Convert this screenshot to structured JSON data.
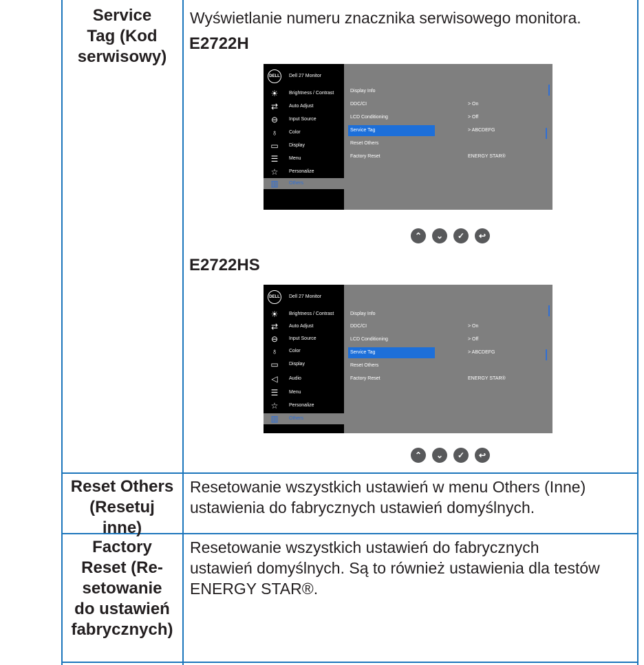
{
  "service_tag": {
    "label": "Service Tag (Kod serwisowy)",
    "label_lines": [
      "Service",
      "Tag (Kod",
      "serwisowy)"
    ],
    "description": "Wyświetlanie numeru znacznika serwisowego monitora.",
    "variants": [
      {
        "model": "E2722H",
        "osd": {
          "title": "Dell 27 Monitor",
          "logo": "DELL",
          "menu": [
            {
              "label": "Brightness / Contrast",
              "icon": "brightness-icon"
            },
            {
              "label": "Auto Adjust",
              "icon": "auto-adjust-icon"
            },
            {
              "label": "Input Source",
              "icon": "input-source-icon"
            },
            {
              "label": "Color",
              "icon": "color-icon"
            },
            {
              "label": "Display",
              "icon": "display-icon"
            },
            {
              "label": "Menu",
              "icon": "menu-icon"
            },
            {
              "label": "Personalize",
              "icon": "star-icon"
            },
            {
              "label": "Others",
              "icon": "others-icon",
              "active": true
            }
          ],
          "submenu": [
            "Display Info",
            "DDC/CI",
            "LCD Conditioning",
            "Service Tag",
            "Reset Others",
            "Factory Reset"
          ],
          "values": [
            "",
            "> On",
            "> Off",
            "> ABCDEFG",
            "",
            "ENERGY STAR®"
          ]
        }
      },
      {
        "model": "E2722HS",
        "osd": {
          "title": "Dell 27 Monitor",
          "logo": "DELL",
          "menu": [
            {
              "label": "Brightness / Contrast",
              "icon": "brightness-icon"
            },
            {
              "label": "Auto Adjust",
              "icon": "auto-adjust-icon"
            },
            {
              "label": "Input Source",
              "icon": "input-source-icon"
            },
            {
              "label": "Color",
              "icon": "color-icon"
            },
            {
              "label": "Display",
              "icon": "display-icon"
            },
            {
              "label": "Audio",
              "icon": "audio-icon"
            },
            {
              "label": "Menu",
              "icon": "menu-icon"
            },
            {
              "label": "Personalize",
              "icon": "star-icon"
            },
            {
              "label": "Others",
              "icon": "others-icon",
              "active": true
            }
          ],
          "submenu": [
            "Display Info",
            "DDC/CI",
            "LCD Conditioning",
            "Service Tag",
            "Reset Others",
            "Factory Reset"
          ],
          "values": [
            "",
            "> On",
            "> Off",
            "> ABCDEFG",
            "",
            "ENERGY STAR®"
          ]
        }
      }
    ],
    "buttons": [
      "up-icon",
      "down-icon",
      "check-icon",
      "back-icon"
    ]
  },
  "reset_others": {
    "label_lines": [
      "Reset Others",
      "(Resetuj",
      "inne)"
    ],
    "description_lines": [
      "Resetowanie wszystkich ustawień w menu Others (Inne)",
      "ustawienia do fabrycznych ustawień domyślnych."
    ]
  },
  "factory_reset": {
    "label_lines": [
      "Factory",
      "Reset (Re-",
      "setowanie",
      "do ustawień",
      "fabrycznych)"
    ],
    "description_lines": [
      "Resetowanie wszystkich ustawień do fabrycznych",
      "ustawień domyślnych. Są to również ustawienia dla testów",
      "ENERGY STAR®."
    ]
  },
  "colors": {
    "border": "#1b75bb",
    "osd_bg": "#7f7f7f",
    "osd_sidebar": "#000000",
    "highlight": "#1d6fd9"
  }
}
